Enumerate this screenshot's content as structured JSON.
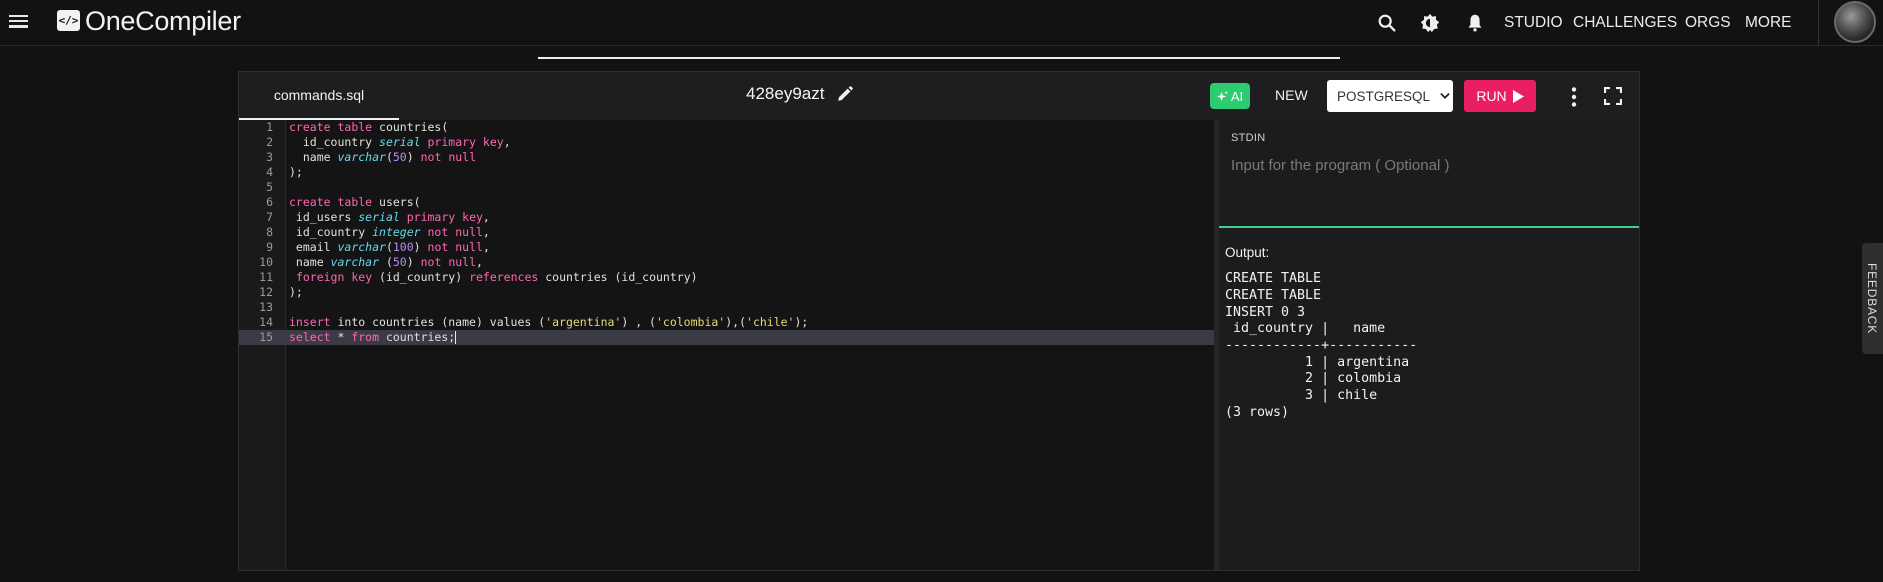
{
  "nav": {
    "logo_glyph": "</>",
    "brand": "OneCompiler",
    "links": [
      "STUDIO",
      "CHALLENGES",
      "ORGS",
      "MORE"
    ],
    "icons": [
      "menu-icon",
      "search-icon",
      "theme-toggle-icon",
      "bell-icon"
    ]
  },
  "editor": {
    "file_tab": "commands.sql",
    "title": "428ey9azt",
    "ai_label": "AI",
    "new_label": "NEW",
    "language": "POSTGRESQL",
    "run_label": "RUN",
    "line_numbers": [
      "1",
      "2",
      "3",
      "4",
      "5",
      "6",
      "7",
      "8",
      "9",
      "10",
      "11",
      "12",
      "13",
      "14",
      "15"
    ],
    "active_line": 15,
    "code_lines": [
      "create table countries(",
      "  id_country serial primary key,",
      "  name varchar(50) not null",
      ");",
      "",
      "create table users(",
      " id_users serial primary key,",
      " id_country integer not null,",
      " email varchar(100) not null,",
      " name varchar (50) not null,",
      " foreign key (id_country) references countries (id_country)",
      ");",
      "",
      "insert into countries (name) values ('argentina') , ('colombia'),('chile');",
      "select * from countries;"
    ]
  },
  "stdin": {
    "label": "STDIN",
    "placeholder": "Input for the program ( Optional )"
  },
  "output": {
    "label": "Output:",
    "lines": [
      "CREATE TABLE",
      "CREATE TABLE",
      "INSERT 0 3",
      " id_country |   name",
      "------------+-----------",
      "          1 | argentina",
      "          2 | colombia",
      "          3 | chile",
      "(3 rows)"
    ]
  },
  "feedback_label": "FEEDBACK",
  "colors": {
    "ai_button": "#2ecc71",
    "run_button": "#e91e63",
    "stdin_border": "#3ecf8e",
    "keyword": "#ff66b3",
    "type": "#66d9ef",
    "string": "#e6db74",
    "number": "#b78af2"
  }
}
